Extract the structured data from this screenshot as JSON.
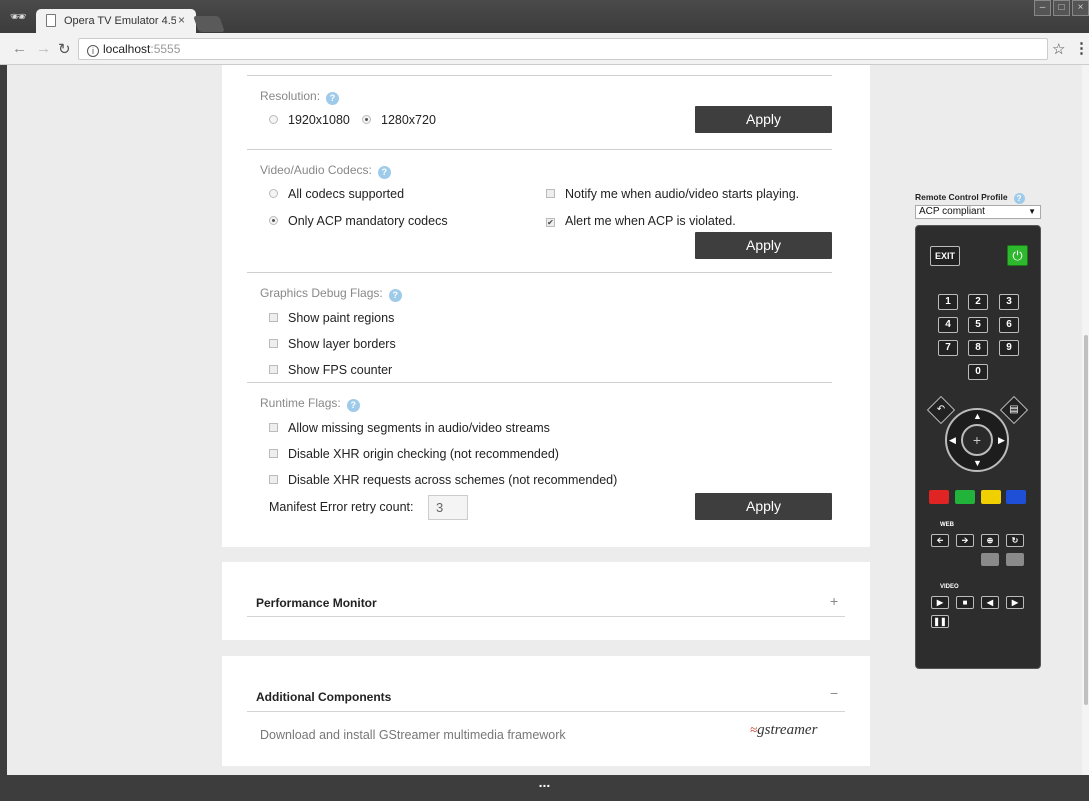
{
  "browser": {
    "tab_title": "Opera TV Emulator 4.5",
    "tab_close": "×",
    "address_host": "localhost",
    "address_port": ":5555"
  },
  "settings": {
    "resolution": {
      "heading": "Resolution:",
      "options": [
        "1920x1080",
        "1280x720"
      ],
      "selected": "1280x720",
      "apply": "Apply"
    },
    "codecs": {
      "heading": "Video/Audio Codecs:",
      "option_all": "All codecs supported",
      "option_acp": "Only ACP mandatory codecs",
      "selected": "Only ACP mandatory codecs",
      "notify_label": "Notify me when audio/video starts playing.",
      "notify_checked": false,
      "alert_label": "Alert me when ACP is violated.",
      "alert_checked": true,
      "apply": "Apply"
    },
    "graphics": {
      "heading": "Graphics Debug Flags:",
      "flags": [
        "Show paint regions",
        "Show layer borders",
        "Show FPS counter"
      ]
    },
    "runtime": {
      "heading": "Runtime Flags:",
      "flags": [
        "Allow missing segments in audio/video streams",
        "Disable XHR origin checking (not recommended)",
        "Disable XHR requests across schemes (not recommended)"
      ],
      "retry_label": "Manifest Error retry count:",
      "retry_value": "3",
      "apply": "Apply"
    }
  },
  "performance": {
    "title": "Performance Monitor",
    "toggle": "+"
  },
  "additional": {
    "title": "Additional Components",
    "toggle": "−",
    "gstreamer_desc": "Download and install GStreamer multimedia framework",
    "gstreamer_logo": "gstreamer"
  },
  "remote": {
    "profile_label": "Remote Control Profile",
    "profile_value": "ACP compliant",
    "exit": "EXIT",
    "digits": [
      "1",
      "2",
      "3",
      "4",
      "5",
      "6",
      "7",
      "8",
      "9",
      "0"
    ],
    "web_label": "WEB",
    "video_label": "VIDEO",
    "colors": [
      "#e02424",
      "#22b33a",
      "#f0d000",
      "#1f4fd6"
    ]
  },
  "bottom_bar": "..."
}
